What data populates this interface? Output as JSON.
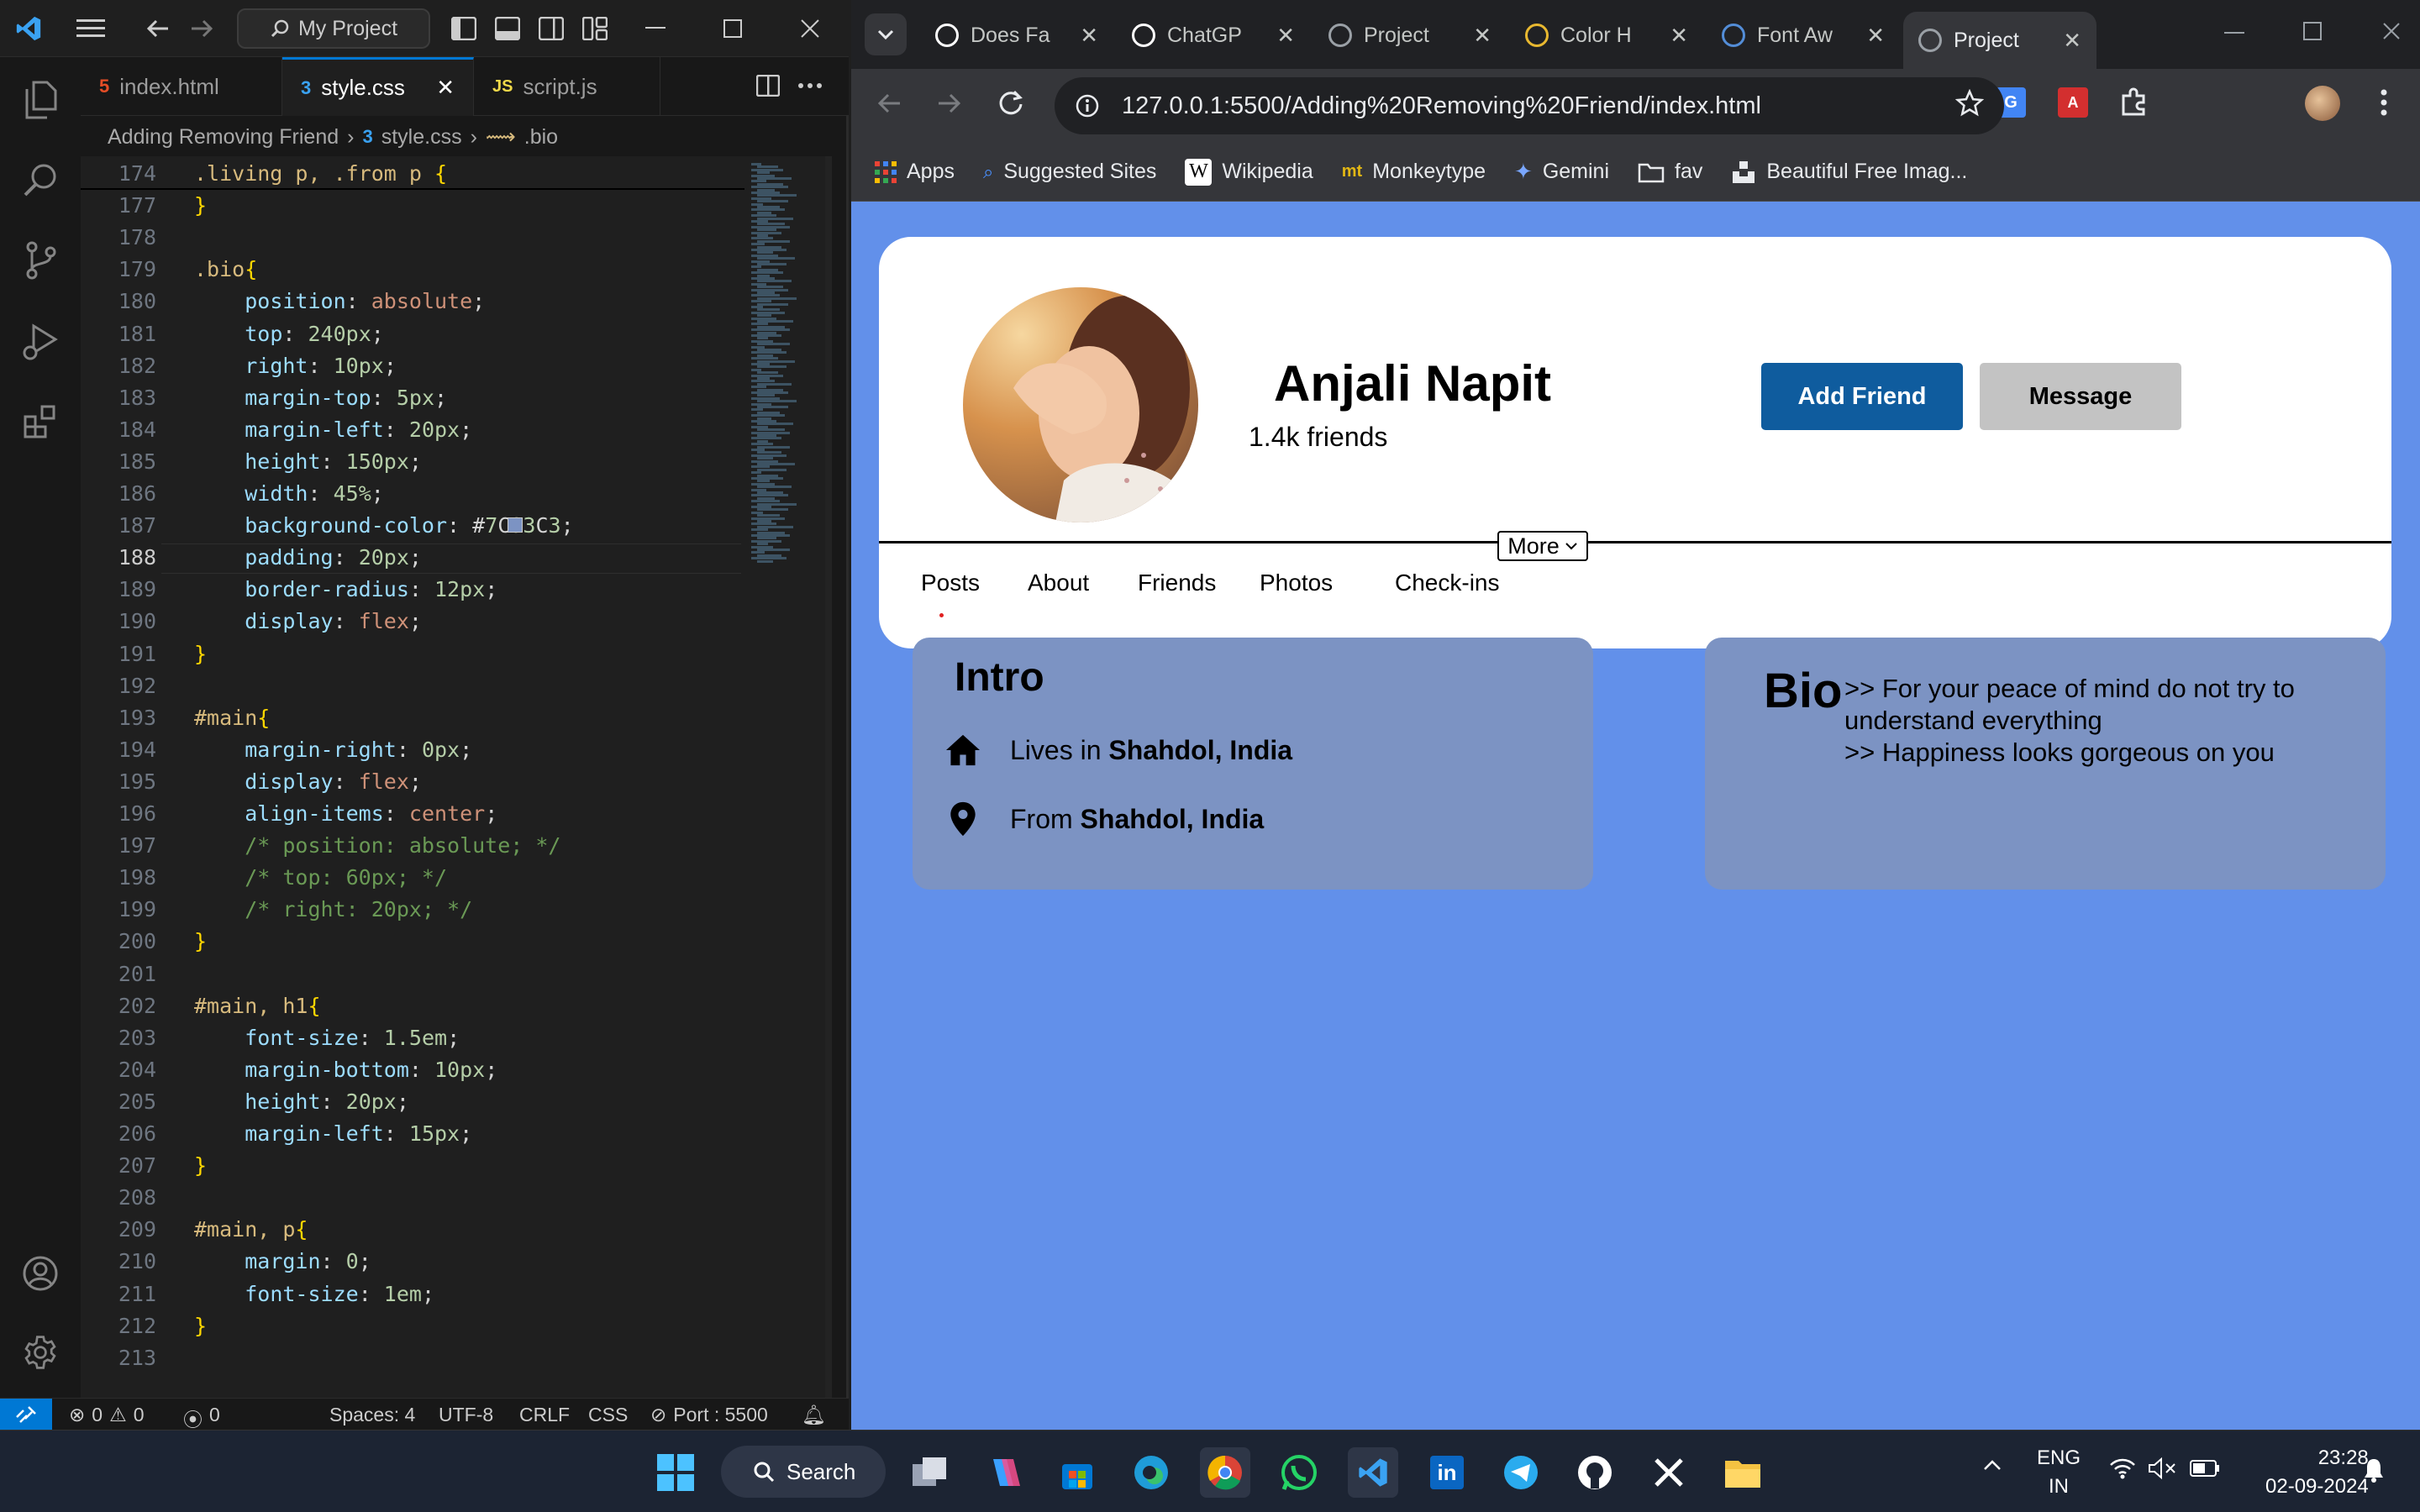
{
  "vscode": {
    "search_label": "My Project",
    "tabs": [
      {
        "label": "index.html",
        "icon": "html-file-icon"
      },
      {
        "label": "style.css",
        "icon": "css-file-icon"
      },
      {
        "label": "script.js",
        "icon": "js-file-icon"
      }
    ],
    "tab_close": "✕",
    "breadcrumb": {
      "folder": "Adding Removing Friend",
      "file": "style.css",
      "symbol": ".bio"
    },
    "code_lines": [
      {
        "n": "174",
        "t": ".living p, .from p {"
      },
      {
        "n": "177",
        "t": "}"
      },
      {
        "n": "178",
        "t": ""
      },
      {
        "n": "179",
        "t": ".bio{"
      },
      {
        "n": "180",
        "t": "    position: absolute;"
      },
      {
        "n": "181",
        "t": "    top: 240px;"
      },
      {
        "n": "182",
        "t": "    right: 10px;"
      },
      {
        "n": "183",
        "t": "    margin-top: 5px;"
      },
      {
        "n": "184",
        "t": "    margin-left: 20px;"
      },
      {
        "n": "185",
        "t": "    height: 150px;"
      },
      {
        "n": "186",
        "t": "    width: 45%;"
      },
      {
        "n": "187",
        "t": "    background-color:   #7C93C3;"
      },
      {
        "n": "188",
        "t": "    padding: 20px;"
      },
      {
        "n": "189",
        "t": "    border-radius: 12px;"
      },
      {
        "n": "190",
        "t": "    display: flex;"
      },
      {
        "n": "191",
        "t": "}"
      },
      {
        "n": "192",
        "t": ""
      },
      {
        "n": "193",
        "t": "#main{"
      },
      {
        "n": "194",
        "t": "    margin-right: 0px;"
      },
      {
        "n": "195",
        "t": "    display: flex;"
      },
      {
        "n": "196",
        "t": "    align-items: center;"
      },
      {
        "n": "197",
        "t": "    /* position: absolute; */"
      },
      {
        "n": "198",
        "t": "    /* top: 60px; */"
      },
      {
        "n": "199",
        "t": "    /* right: 20px; */"
      },
      {
        "n": "200",
        "t": "}"
      },
      {
        "n": "201",
        "t": ""
      },
      {
        "n": "202",
        "t": "#main, h1{"
      },
      {
        "n": "203",
        "t": "    font-size: 1.5em;"
      },
      {
        "n": "204",
        "t": "    margin-bottom: 10px;"
      },
      {
        "n": "205",
        "t": "    height: 20px;"
      },
      {
        "n": "206",
        "t": "    margin-left: 15px;"
      },
      {
        "n": "207",
        "t": "}"
      },
      {
        "n": "208",
        "t": ""
      },
      {
        "n": "209",
        "t": "#main, p{"
      },
      {
        "n": "210",
        "t": "    margin: 0;"
      },
      {
        "n": "211",
        "t": "    font-size: 1em;"
      },
      {
        "n": "212",
        "t": "}"
      },
      {
        "n": "213",
        "t": ""
      }
    ],
    "current_line": "188",
    "color_swatch": "#7C93C3",
    "status": {
      "errors": "0",
      "warnings": "0",
      "ports": "0",
      "spaces": "Spaces: 4",
      "encoding": "UTF-8",
      "eol": "CRLF",
      "language": "CSS",
      "port": "Port : 5500"
    }
  },
  "chrome": {
    "tabs": [
      {
        "label": "Does Fa",
        "icon": "github-icon"
      },
      {
        "label": "ChatGP",
        "icon": "chatgpt-icon"
      },
      {
        "label": "Project",
        "icon": "globe-icon"
      },
      {
        "label": "Color H",
        "icon": "color-hunt-icon"
      },
      {
        "label": "Font Aw",
        "icon": "font-awesome-icon"
      },
      {
        "label": "Project",
        "icon": "globe-icon"
      }
    ],
    "url": "127.0.0.1:5500/Adding%20Removing%20Friend/index.html",
    "bookmarks": [
      "Apps",
      "Suggested Sites",
      "Wikipedia",
      "Monkeytype",
      "Gemini",
      "fav",
      "Beautiful Free Imag..."
    ]
  },
  "profile_page": {
    "name": "Anjali Napit",
    "friends": "1.4k friends",
    "add_friend": "Add Friend",
    "message": "Message",
    "more": "More",
    "nav": [
      "Posts",
      "About",
      "Friends",
      "Photos",
      "Check-ins"
    ],
    "intro": {
      "title": "Intro",
      "lives_prefix": "Lives in",
      "lives_place": "Shahdol, India",
      "from_prefix": "From",
      "from_place": "Shahdol, India"
    },
    "bio": {
      "title": "Bio",
      "line1": ">> For your peace of mind do not try to understand everything",
      "line2": ">> Happiness looks gorgeous on you"
    },
    "colors": {
      "page_bg": "#6290EA",
      "panel_bg": "#7C93C3",
      "add_btn": "#0F5C9E",
      "msg_btn": "#C3C3C3"
    }
  },
  "taskbar": {
    "search_label": "Search",
    "lang": "ENG",
    "region": "IN",
    "time": "23:28",
    "date": "02-09-2024"
  }
}
